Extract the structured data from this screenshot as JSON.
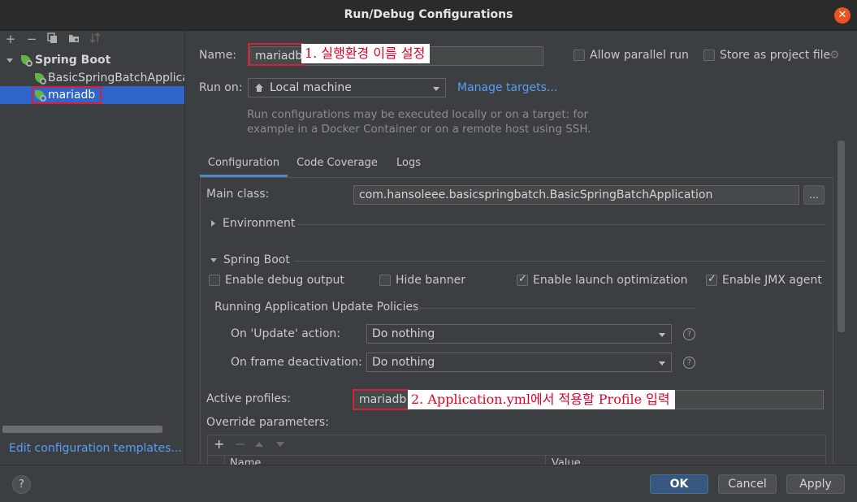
{
  "window": {
    "title": "Run/Debug Configurations"
  },
  "sidebar": {
    "tree": [
      {
        "label": "Spring Boot",
        "type": "group"
      },
      {
        "label": "BasicSpringBatchApplica",
        "type": "config"
      },
      {
        "label": "mariadb",
        "type": "config",
        "selected": true
      }
    ],
    "footer_link": "Edit configuration templates..."
  },
  "form": {
    "name_label": "Name:",
    "name_value": "mariadb",
    "allow_parallel": {
      "label": "Allow parallel run",
      "checked": false
    },
    "store_project": {
      "label": "Store as project file",
      "checked": false
    },
    "run_on_label": "Run on:",
    "run_on_value": "Local machine",
    "manage_targets": "Manage targets...",
    "run_on_help_1": "Run configurations may be executed locally or on a target: for",
    "run_on_help_2": "example in a Docker Container or on a remote host using SSH."
  },
  "tabs": [
    {
      "label": "Configuration",
      "active": true
    },
    {
      "label": "Code Coverage",
      "active": false
    },
    {
      "label": "Logs",
      "active": false
    }
  ],
  "config": {
    "main_class_label": "Main class:",
    "main_class_value": "com.hansoleee.basicspringbatch.BasicSpringBatchApplication",
    "browse_label": "...",
    "environment_label": "Environment",
    "spring_boot_label": "Spring Boot",
    "checks": [
      {
        "label": "Enable debug output",
        "checked": false
      },
      {
        "label": "Hide banner",
        "checked": false
      },
      {
        "label": "Enable launch optimization",
        "checked": true
      },
      {
        "label": "Enable JMX agent",
        "checked": true
      }
    ],
    "policies_label": "Running Application Update Policies",
    "on_update_label": "On 'Update' action:",
    "on_update_value": "Do nothing",
    "on_frame_label": "On frame deactivation:",
    "on_frame_value": "Do nothing",
    "active_profiles_label": "Active profiles:",
    "active_profiles_value": "mariadb",
    "override_label": "Override parameters:",
    "table_headers": [
      "Name",
      "Value"
    ]
  },
  "annotations": {
    "one": "1. 실행환경 이름 설정",
    "two": "2. Application.yml에서 적용할 Profile 입력"
  },
  "buttons": {
    "ok": "OK",
    "cancel": "Cancel",
    "apply": "Apply",
    "help": "?"
  },
  "colors": {
    "accent": "#2f65ca",
    "annotation_red": "#e0002a",
    "spring_green": "#62b543"
  }
}
